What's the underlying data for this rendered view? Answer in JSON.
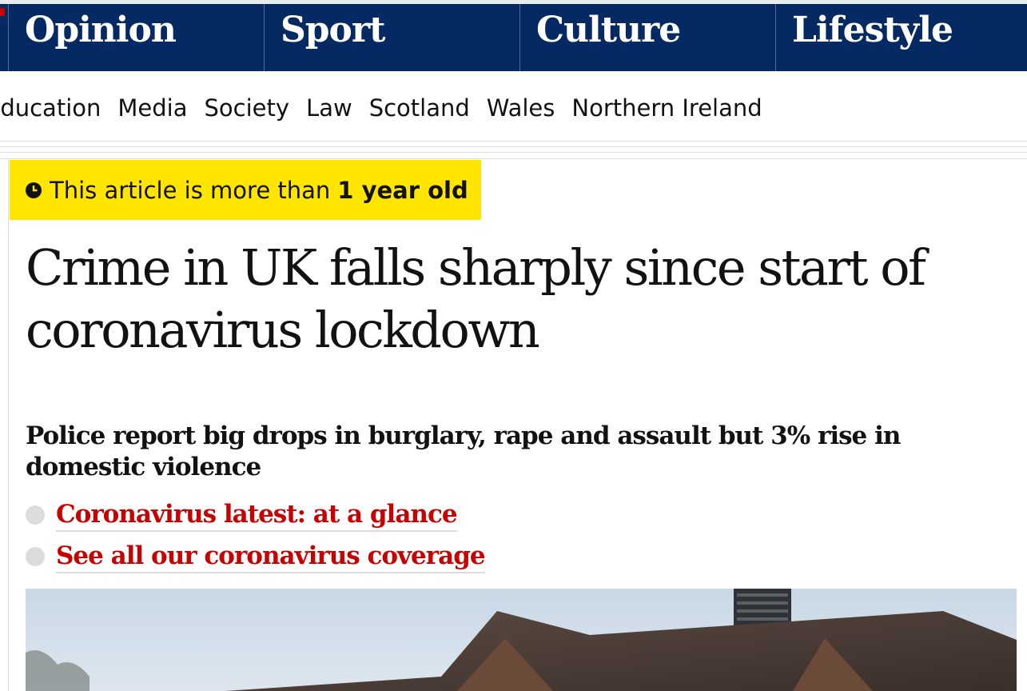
{
  "top_nav": {
    "pillars": [
      "Opinion",
      "Sport",
      "Culture",
      "Lifestyle"
    ]
  },
  "sub_nav": {
    "items": [
      "Education",
      "Media",
      "Society",
      "Law",
      "Scotland",
      "Wales",
      "Northern Ireland"
    ]
  },
  "age_warning": {
    "prefix": "This article is more than",
    "emphasis": "1 year old",
    "icon": "clock-icon"
  },
  "article": {
    "headline": "Crime in UK falls sharply since start of coronavirus lockdown",
    "standfirst": "Police report big drops in burglary, rape and assault but 3% rise in domestic violence",
    "related_links": [
      "Coronavirus latest: at a glance",
      "See all our coronavirus coverage"
    ]
  },
  "colors": {
    "nav_background": "#052962",
    "age_warning_background": "#ffe500",
    "link_red": "#c70000"
  }
}
